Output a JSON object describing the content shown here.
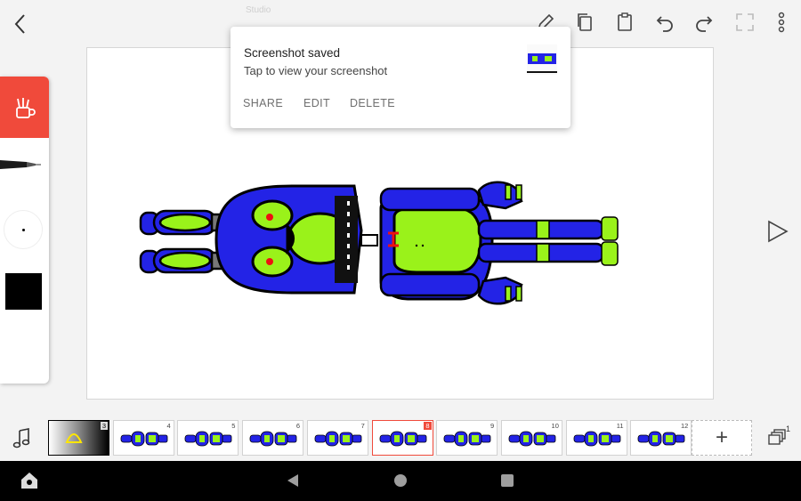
{
  "status_bar": {
    "title_text": "Studio"
  },
  "toolbar": {
    "back_icon": "back-arrow-icon",
    "pencil_icon": "pencil-icon",
    "copy_icon": "copy-icon",
    "paste_icon": "clipboard-icon",
    "undo_icon": "undo-icon",
    "redo_icon": "redo-icon",
    "fullscreen_icon": "fullscreen-icon",
    "menu_icon": "more-vertical-icon"
  },
  "notification": {
    "title": "Screenshot saved",
    "subtitle": "Tap to view your screenshot",
    "actions": [
      "SHARE",
      "EDIT",
      "DELETE"
    ]
  },
  "tools": {
    "active_tool_icon": "brushes-cup-icon",
    "brush_icon": "pen-icon",
    "current_color": "#000000"
  },
  "timeline": {
    "frames": [
      {
        "num": "3",
        "kind": "dark"
      },
      {
        "num": "4",
        "kind": "robot"
      },
      {
        "num": "5",
        "kind": "robot"
      },
      {
        "num": "6",
        "kind": "robot"
      },
      {
        "num": "7",
        "kind": "robot"
      },
      {
        "num": "8",
        "kind": "robot",
        "selected": true
      },
      {
        "num": "9",
        "kind": "robot"
      },
      {
        "num": "10",
        "kind": "robot"
      },
      {
        "num": "11",
        "kind": "robot"
      },
      {
        "num": "12",
        "kind": "robot"
      }
    ],
    "add_label": "+",
    "layers_count": "1"
  },
  "colors": {
    "accent": "#f04a3b",
    "robot_blue": "#2323e6",
    "robot_green": "#9af21a"
  }
}
